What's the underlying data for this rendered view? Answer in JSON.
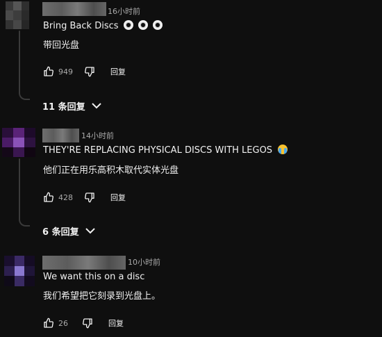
{
  "comments": [
    {
      "timestamp": "16小时前",
      "text": "Bring Back Discs",
      "emoji": [
        "optical-disc",
        "optical-disc",
        "optical-disc"
      ],
      "translation": "带回光盘",
      "likes": "949",
      "reply_label": "回复",
      "replies_label": "11 条回复"
    },
    {
      "timestamp": "14小时前",
      "text": "THEY'RE REPLACING PHYSICAL DISCS WITH LEGOS",
      "emoji": [
        "loudly-crying-face"
      ],
      "translation": "他们正在用乐高积木取代实体光盘",
      "likes": "428",
      "reply_label": "回复",
      "replies_label": "6 条回复"
    },
    {
      "timestamp": "10小时前",
      "text": "We want this on a disc",
      "translation": "我们希望把它刻录到光盘上。",
      "likes": "26",
      "reply_label": "回复"
    }
  ],
  "colors": {
    "background": "#0f0f0f",
    "text": "#f1f1f1",
    "secondary_text": "#aaaaaa",
    "thread_line": "#3a3a3a"
  }
}
